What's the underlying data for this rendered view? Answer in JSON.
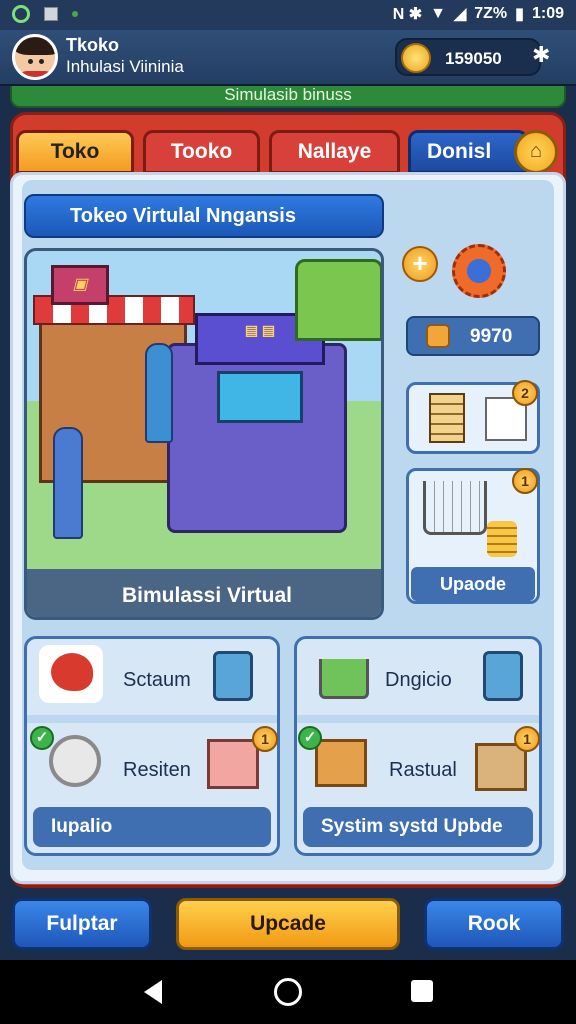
{
  "status_bar": {
    "indicators": "N ✱",
    "battery": "7Z%",
    "time": "1:09"
  },
  "header": {
    "title": "Tkoko",
    "subtitle": "Inhulasi Viininia",
    "coins": "159050"
  },
  "banner": "Simulasib binuss",
  "tabs": [
    {
      "label": "Toko"
    },
    {
      "label": "Tooko"
    },
    {
      "label": "Nallaye"
    },
    {
      "label": "Donisl"
    }
  ],
  "main": {
    "heading": "Tokeo Virtulal Nngansis",
    "hero_caption": "Bimulassi Virtual"
  },
  "side": {
    "stat_value": "9970",
    "card_badge": "2",
    "upgrade_badge": "1",
    "upgrade_label": "Upaode"
  },
  "panels": {
    "left": {
      "item1": "Sctaum",
      "item2": "Resiten",
      "badge": "1",
      "bar": "Iupalio"
    },
    "right": {
      "item1": "Dngicio",
      "item2": "Rastual",
      "badge": "1",
      "bar": "Systim systd Upbde"
    }
  },
  "footer": {
    "left": "Fulptar",
    "center": "Upcade",
    "right": "Rook"
  },
  "colors": {
    "accent_blue": "#2f7ae0",
    "accent_orange": "#f39c1f",
    "accent_red": "#d23c2c",
    "panel_bg": "#bcd8ef"
  }
}
